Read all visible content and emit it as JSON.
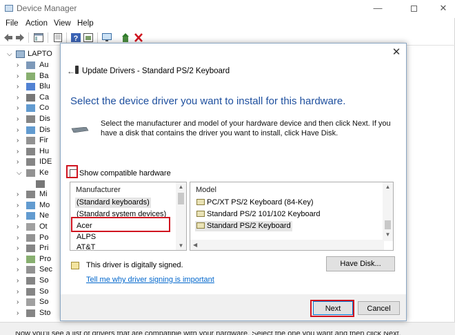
{
  "window": {
    "title": "Device Manager",
    "minimize_glyph": "—",
    "close_glyph": "✕"
  },
  "menu": [
    "File",
    "Action",
    "View",
    "Help"
  ],
  "tree": {
    "root_label": "LAPTO",
    "items": [
      {
        "label": "Au",
        "icon": "audio-icon"
      },
      {
        "label": "Ba",
        "icon": "battery-icon"
      },
      {
        "label": "Blu",
        "icon": "bluetooth-icon"
      },
      {
        "label": "Ca",
        "icon": "camera-icon"
      },
      {
        "label": "Co",
        "icon": "computer-icon"
      },
      {
        "label": "Dis",
        "icon": "disk-icon"
      },
      {
        "label": "Dis",
        "icon": "display-icon"
      },
      {
        "label": "Fir",
        "icon": "firmware-icon"
      },
      {
        "label": "Hu",
        "icon": "hid-icon"
      },
      {
        "label": "IDE",
        "icon": "ide-icon"
      },
      {
        "label": "Ke",
        "icon": "keyboard-icon",
        "expanded": true
      },
      {
        "label": "",
        "icon": "keyboard-device-icon",
        "child": true
      },
      {
        "label": "Mi",
        "icon": "mouse-icon"
      },
      {
        "label": "Mo",
        "icon": "monitor-icon"
      },
      {
        "label": "Ne",
        "icon": "network-icon"
      },
      {
        "label": "Ot",
        "icon": "other-device-icon"
      },
      {
        "label": "Po",
        "icon": "port-icon"
      },
      {
        "label": "Pri",
        "icon": "print-queue-icon"
      },
      {
        "label": "Pro",
        "icon": "processor-icon"
      },
      {
        "label": "Sec",
        "icon": "security-icon"
      },
      {
        "label": "So",
        "icon": "software-component-icon"
      },
      {
        "label": "So",
        "icon": "software-device-icon"
      },
      {
        "label": "So",
        "icon": "sound-icon"
      },
      {
        "label": "Sto",
        "icon": "storage-icon"
      }
    ]
  },
  "dialog": {
    "title": "Update Drivers - Standard PS/2 Keyboard",
    "back_glyph": "←",
    "close_glyph": "✕",
    "heading": "Select the device driver you want to install for this hardware.",
    "description": "Select the manufacturer and model of your hardware device and then click Next. If you have a disk that contains the driver you want to install, click Have Disk.",
    "compatible_label": "Show compatible hardware",
    "compatible_checked": false,
    "manufacturer": {
      "header": "Manufacturer",
      "items": [
        "(Standard keyboards)",
        "(Standard system devices)",
        "Acer",
        "ALPS",
        "AT&T"
      ],
      "selected_index": 0
    },
    "model": {
      "header": "Model",
      "items": [
        "PC/XT PS/2 Keyboard (84-Key)",
        "Standard PS/2 101/102 Keyboard",
        "Standard PS/2 Keyboard"
      ],
      "selected_index": 2
    },
    "signed_text": "This driver is digitally signed.",
    "signing_link": "Tell me why driver signing is important",
    "have_disk_label": "Have Disk...",
    "next_label": "Next",
    "cancel_label": "Cancel"
  },
  "background_text": "Now you'll see a list of drivers that are compatible with your hardware. Select the one you want and then click Next.",
  "colors": {
    "heading_blue": "#1e4f9e",
    "link_blue": "#0066cc",
    "highlight_red": "#d0131f",
    "focus_blue": "#0078d7"
  }
}
